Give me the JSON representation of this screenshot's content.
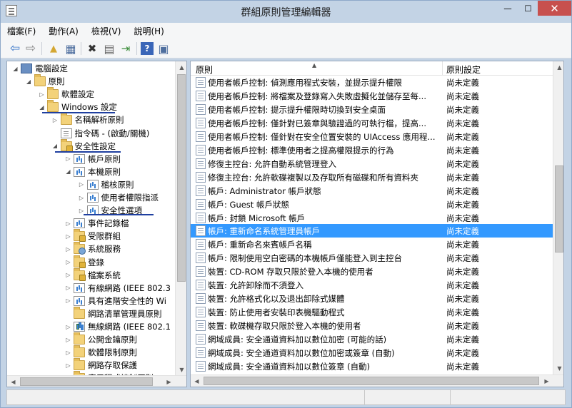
{
  "window": {
    "title": "群組原則管理編輯器",
    "minimize_glyph": "—",
    "maximize_glyph": "☐",
    "close_glyph": "✕"
  },
  "menu": [
    {
      "label": "檔案(F)"
    },
    {
      "label": "動作(A)"
    },
    {
      "label": "檢視(V)"
    },
    {
      "label": "說明(H)"
    }
  ],
  "toolbar": [
    {
      "icon": "back-arrow-icon",
      "glyph": "⇦"
    },
    {
      "icon": "forward-arrow-icon",
      "glyph": "⇨"
    },
    {
      "icon": "up-folder-icon",
      "glyph": "▲"
    },
    {
      "icon": "show-hide-tree-icon",
      "glyph": "▦"
    },
    {
      "icon": "delete-icon",
      "glyph": "✖"
    },
    {
      "icon": "properties-icon",
      "glyph": "▤"
    },
    {
      "icon": "export-list-icon",
      "glyph": "⇥"
    },
    {
      "icon": "help-icon",
      "glyph": "?"
    },
    {
      "icon": "show-action-pane-icon",
      "glyph": "▣"
    }
  ],
  "tree": [
    {
      "label": "電腦設定",
      "level": 0,
      "arrow": "◢",
      "icon": "comp"
    },
    {
      "label": "原則",
      "level": 1,
      "arrow": "◢",
      "icon": "folder"
    },
    {
      "label": "軟體設定",
      "level": 2,
      "arrow": "▷",
      "icon": "folder"
    },
    {
      "label": "Windows 設定",
      "level": 2,
      "arrow": "◢",
      "icon": "folder"
    },
    {
      "label": "名稱解析原則",
      "level": 3,
      "arrow": "▷",
      "icon": "folder"
    },
    {
      "label": "指令碼 - (啟動/關機)",
      "level": 3,
      "arrow": "",
      "icon": "doc"
    },
    {
      "label": "安全性設定",
      "level": 3,
      "arrow": "◢",
      "icon": "lock"
    },
    {
      "label": "帳戶原則",
      "level": 4,
      "arrow": "▷",
      "icon": "chart"
    },
    {
      "label": "本機原則",
      "level": 4,
      "arrow": "◢",
      "icon": "chart"
    },
    {
      "label": "稽核原則",
      "level": 5,
      "arrow": "▷",
      "icon": "chart"
    },
    {
      "label": "使用者權限指派",
      "level": 5,
      "arrow": "▷",
      "icon": "chart"
    },
    {
      "label": "安全性選項",
      "level": 5,
      "arrow": "▷",
      "icon": "chart"
    },
    {
      "label": "事件記錄檔",
      "level": 4,
      "arrow": "▷",
      "icon": "chart"
    },
    {
      "label": "受限群組",
      "level": 4,
      "arrow": "▷",
      "icon": "lock"
    },
    {
      "label": "系統服務",
      "level": 4,
      "arrow": "▷",
      "icon": "gear"
    },
    {
      "label": "登錄",
      "level": 4,
      "arrow": "▷",
      "icon": "lock"
    },
    {
      "label": "檔案系統",
      "level": 4,
      "arrow": "▷",
      "icon": "lock"
    },
    {
      "label": "有線網路 (IEEE 802.3",
      "level": 4,
      "arrow": "▷",
      "icon": "chart"
    },
    {
      "label": "具有進階安全性的 Wi",
      "level": 4,
      "arrow": "▷",
      "icon": "chart"
    },
    {
      "label": "網路清單管理員原則",
      "level": 4,
      "arrow": "",
      "icon": "folder"
    },
    {
      "label": "無線網路 (IEEE 802.1",
      "level": 4,
      "arrow": "▷",
      "icon": "net"
    },
    {
      "label": "公開金鑰原則",
      "level": 4,
      "arrow": "▷",
      "icon": "folder"
    },
    {
      "label": "軟體限制原則",
      "level": 4,
      "arrow": "▷",
      "icon": "folder"
    },
    {
      "label": "網路存取保護",
      "level": 4,
      "arrow": "▷",
      "icon": "folder"
    },
    {
      "label": "應用程式控制原則",
      "level": 4,
      "arrow": "▷",
      "icon": "folder"
    }
  ],
  "list": {
    "col_policy": "原則",
    "col_setting": "原則設定",
    "sort_glyph": "▲",
    "rows": [
      {
        "policy": "使用者帳戶控制: 偵測應用程式安裝，並提示提升權限",
        "setting": "尚未定義"
      },
      {
        "policy": "使用者帳戶控制: 將檔案及登錄寫入失敗虛擬化並儲存至每...",
        "setting": "尚未定義"
      },
      {
        "policy": "使用者帳戶控制: 提示提升權限時切換到安全桌面",
        "setting": "尚未定義"
      },
      {
        "policy": "使用者帳戶控制: 僅針對已簽章與驗證過的可執行檔，提高...",
        "setting": "尚未定義"
      },
      {
        "policy": "使用者帳戶控制: 僅針對在安全位置安裝的 UIAccess 應用程...",
        "setting": "尚未定義"
      },
      {
        "policy": "使用者帳戶控制: 標準使用者之提高權限提示的行為",
        "setting": "尚未定義"
      },
      {
        "policy": "修復主控台: 允許自動系統管理登入",
        "setting": "尚未定義"
      },
      {
        "policy": "修復主控台: 允許軟碟複製以及存取所有磁碟和所有資料夾",
        "setting": "尚未定義"
      },
      {
        "policy": "帳戶: Administrator 帳戶狀態",
        "setting": "尚未定義"
      },
      {
        "policy": "帳戶: Guest 帳戶狀態",
        "setting": "尚未定義"
      },
      {
        "policy": "帳戶: 封鎖 Microsoft 帳戶",
        "setting": "尚未定義"
      },
      {
        "policy": "帳戶: 重新命名系統管理員帳戶",
        "setting": "尚未定義"
      },
      {
        "policy": "帳戶: 重新命名來賓帳戶名稱",
        "setting": "尚未定義"
      },
      {
        "policy": "帳戶: 限制使用空白密碼的本機帳戶僅能登入到主控台",
        "setting": "尚未定義"
      },
      {
        "policy": "裝置: CD-ROM 存取只限於登入本機的使用者",
        "setting": "尚未定義"
      },
      {
        "policy": "裝置: 允許卸除而不須登入",
        "setting": "尚未定義"
      },
      {
        "policy": "裝置: 允許格式化以及退出卸除式媒體",
        "setting": "尚未定義"
      },
      {
        "policy": "裝置: 防止使用者安裝印表機驅動程式",
        "setting": "尚未定義"
      },
      {
        "policy": "裝置: 軟碟機存取只限於登入本機的使用者",
        "setting": "尚未定義"
      },
      {
        "policy": "網域成員: 安全通道資料加以數位加密 (可能的話)",
        "setting": "尚未定義"
      },
      {
        "policy": "網域成員: 安全通道資料加以數位加密或簽章 (自動)",
        "setting": "尚未定義"
      },
      {
        "policy": "網域成員: 安全通道資料加以數位簽章 (自動)",
        "setting": "尚未定義"
      }
    ]
  },
  "scroll_glyphs": {
    "up": "▲",
    "down": "▼",
    "left": "◀",
    "right": "▶"
  }
}
